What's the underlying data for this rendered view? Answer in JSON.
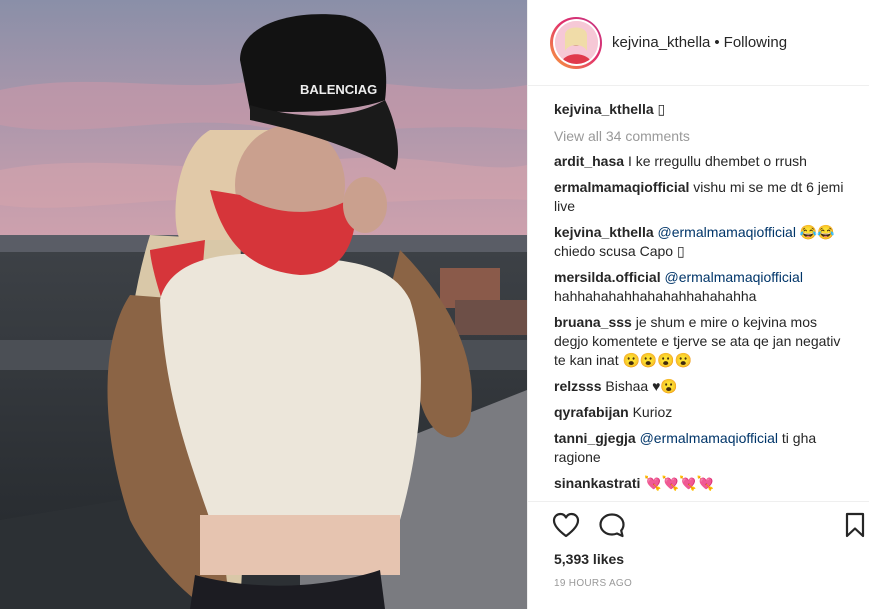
{
  "post": {
    "image_alt": "photo",
    "cap_text": "BALENCIAG"
  },
  "header": {
    "username": "kejvina_kthella",
    "separator": "•",
    "follow_status": "Following"
  },
  "caption": {
    "username": "kejvina_kthella",
    "text": "▯"
  },
  "view_all": "View all 34 comments",
  "comments": [
    {
      "user": "ardit_hasa",
      "mention": "",
      "text": "I ke rregullu dhembet o rrush"
    },
    {
      "user": "ermalmamaqiofficial",
      "mention": "",
      "text": "vishu mi se me dt 6 jemi live"
    },
    {
      "user": "kejvina_kthella",
      "mention": "@ermalmamaqiofficial",
      "text": "😂😂 chiedo scusa Capo ▯"
    },
    {
      "user": "mersilda.official",
      "mention": "@ermalmamaqiofficial",
      "text": "hahhahahahhahahahhahahahha"
    },
    {
      "user": "bruana_sss",
      "mention": "",
      "text": "je shum e mire o kejvina mos degjo komentete e tjerve se ata qe jan negativ te kan inat 😮😮😮😮"
    },
    {
      "user": "relzsss",
      "mention": "",
      "text": "Bishaa ♥😮"
    },
    {
      "user": "qyrafabijan",
      "mention": "",
      "text": "Kurioz"
    },
    {
      "user": "tanni_gjegja",
      "mention": "@ermalmamaqiofficial",
      "text": "ti gha ragione"
    },
    {
      "user": "sinankastrati",
      "mention": "",
      "text": "💘💘💘💘"
    }
  ],
  "actions": {
    "like_icon": "heart-icon",
    "comment_icon": "comment-bubble-icon",
    "save_icon": "bookmark-icon"
  },
  "likes": "5,393 likes",
  "timestamp": "19 HOURS AGO"
}
